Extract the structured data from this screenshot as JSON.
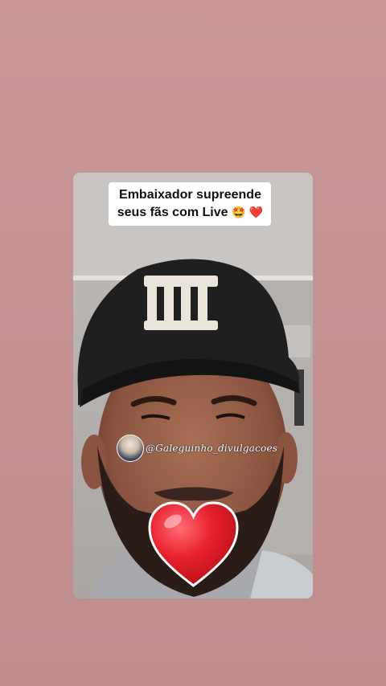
{
  "post": {
    "caption_line1": "Embaixador supreende",
    "caption_line2": "seus fãs com Live",
    "caption_emoji_1": "🤩",
    "caption_emoji_2": "❤️",
    "watermark_handle": "@Galeguinho_divulgacoes"
  },
  "colors": {
    "background": "#c99696",
    "caption_bg": "#ffffff",
    "heart": "#e21b2b"
  },
  "icons": {
    "heart_sticker": "heart-icon",
    "watermark_avatar": "avatar"
  }
}
